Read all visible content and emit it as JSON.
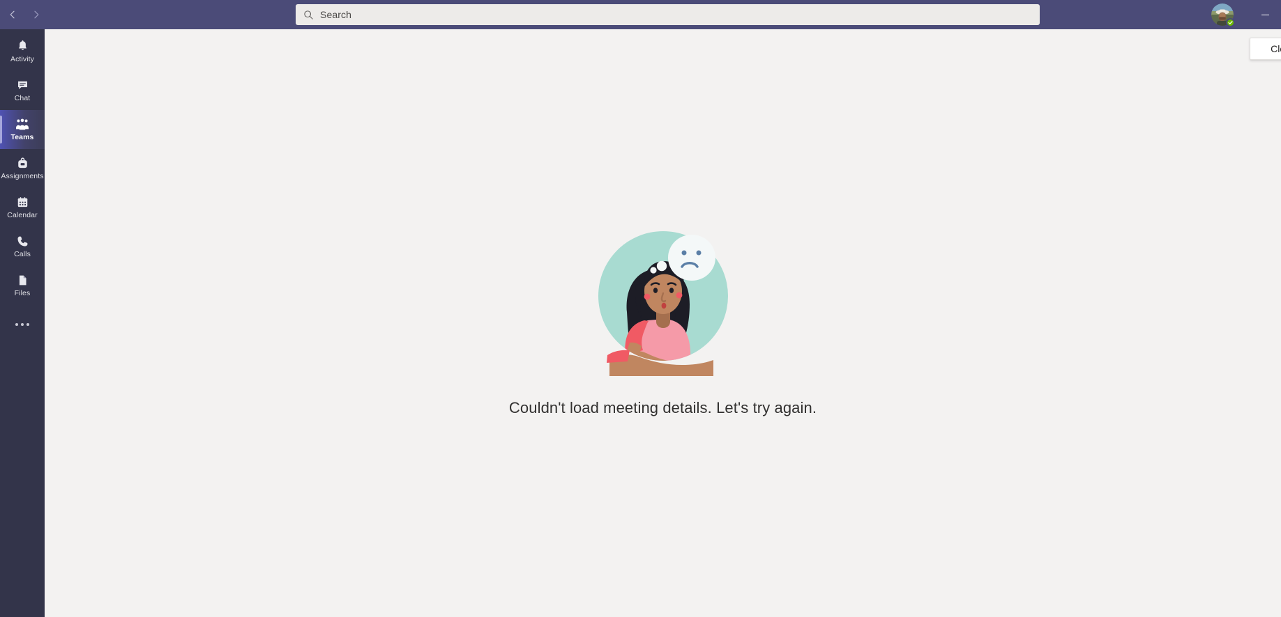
{
  "window": {
    "back_icon": "chevron-left-icon",
    "forward_icon": "chevron-right-icon",
    "minimize_label": "Minimize"
  },
  "search": {
    "placeholder": "Search",
    "value": "",
    "icon": "search-icon"
  },
  "profile": {
    "presence": "Available",
    "presence_color": "#6BB700",
    "avatar_alt": "User avatar"
  },
  "sidebar": {
    "background": "#33344A",
    "active_accent": "#A6A7DC",
    "items": [
      {
        "label": "Activity",
        "icon": "bell-icon",
        "active": false
      },
      {
        "label": "Chat",
        "icon": "chat-icon",
        "active": false
      },
      {
        "label": "Teams",
        "icon": "teams-people-icon",
        "active": true
      },
      {
        "label": "Assignments",
        "icon": "backpack-icon",
        "active": false
      },
      {
        "label": "Calendar",
        "icon": "calendar-icon",
        "active": false
      },
      {
        "label": "Calls",
        "icon": "phone-icon",
        "active": false
      },
      {
        "label": "Files",
        "icon": "file-page-icon",
        "active": false
      }
    ],
    "more_label": "More apps",
    "more_icon": "ellipsis-icon"
  },
  "main": {
    "close_label": "Close",
    "error_message": "Couldn't load meeting details. Let's try again.",
    "illustration": {
      "name": "confused-person-sad-thought-bubble",
      "circle_color": "#A8DBD1",
      "bubble_color": "#F4F8F8",
      "shirt_color": "#F59AA8",
      "sleeve_color": "#F05A64",
      "skin_color": "#C08660",
      "hair_color": "#1D1D26",
      "face_feature_color": "#5B7FA6"
    }
  },
  "colors": {
    "titlebar": "#4B4B78",
    "content_bg": "#F3F2F1",
    "search_bg": "#EDEBE9",
    "text_primary": "#323130"
  }
}
